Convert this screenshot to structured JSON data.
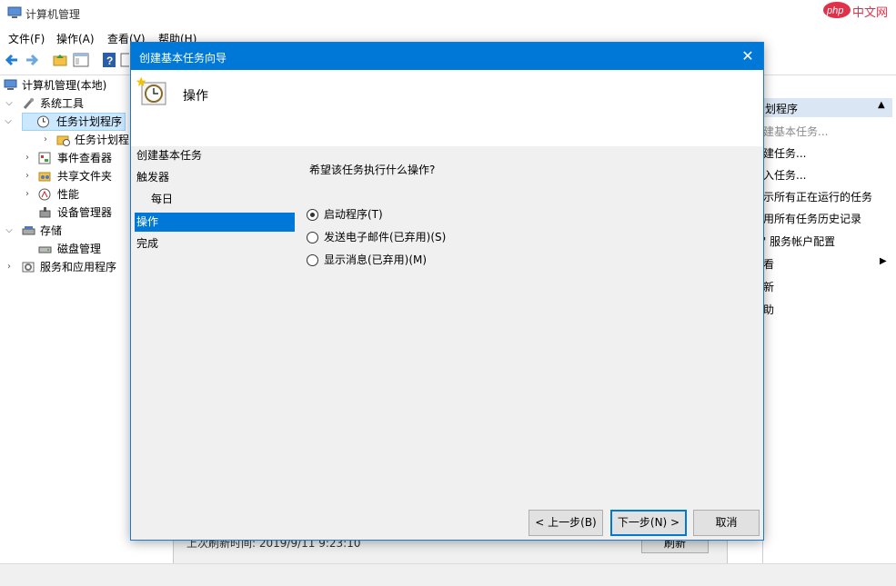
{
  "app": {
    "title": "计算机管理",
    "watermark": "中文网"
  },
  "menu": [
    "文件(F)",
    "操作(A)",
    "查看(V)",
    "帮助(H)"
  ],
  "tree": {
    "root": "计算机管理(本地)",
    "system_tools": "系统工具",
    "task_scheduler": "任务计划程序",
    "task_scheduler_library": "任务计划程",
    "event_viewer": "事件查看器",
    "shared_folders": "共享文件夹",
    "performance": "性能",
    "device_manager": "设备管理器",
    "storage": "存储",
    "disk_management": "磁盘管理",
    "services_apps": "服务和应用程序"
  },
  "actions": {
    "header": "划程序",
    "items": [
      "建基本任务...",
      "建任务...",
      "入任务...",
      "示所有正在运行的任务",
      "用所有任务历史记录",
      "' 服务帐户配置",
      "看",
      "新",
      "助"
    ]
  },
  "behind": {
    "refresh_status": "上次刷新时间: 2019/9/11 9:23:10",
    "refresh_button": "刷新"
  },
  "dialog": {
    "title": "创建基本任务向导",
    "heading": "操作",
    "steps": [
      "创建基本任务",
      "触发器",
      "每日",
      "操作",
      "完成"
    ],
    "question": "希望该任务执行什么操作?",
    "options": [
      "启动程序(T)",
      "发送电子邮件(已弃用)(S)",
      "显示消息(已弃用)(M)"
    ],
    "selected_option": 0,
    "buttons": {
      "back": "< 上一步(B)",
      "next": "下一步(N) >",
      "cancel": "取消"
    }
  },
  "colors": {
    "accent": "#0078d7",
    "selection": "#cce8ff"
  }
}
